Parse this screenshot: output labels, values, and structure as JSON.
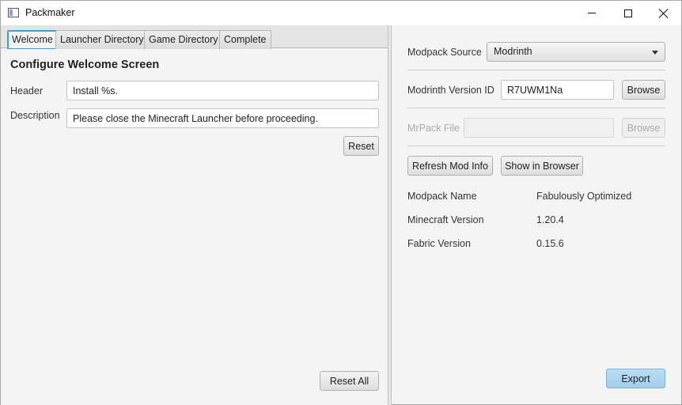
{
  "window": {
    "title": "Packmaker"
  },
  "tabs": [
    {
      "label": "Welcome",
      "active": true
    },
    {
      "label": "Launcher Directory",
      "active": false
    },
    {
      "label": "Game Directory",
      "active": false
    },
    {
      "label": "Complete",
      "active": false
    }
  ],
  "welcome": {
    "section_title": "Configure Welcome Screen",
    "header_label": "Header",
    "header_value": "Install %s.",
    "description_label": "Description",
    "description_value": "Please close the Minecraft Launcher before proceeding.",
    "reset_label": "Reset",
    "reset_all_label": "Reset All"
  },
  "source": {
    "label": "Modpack Source",
    "selected": "Modrinth"
  },
  "modrinth": {
    "label": "Modrinth Version ID",
    "value": "R7UWM1Na",
    "browse_label": "Browse"
  },
  "mrpack": {
    "label": "MrPack File",
    "value": "",
    "browse_label": "Browse"
  },
  "actions": {
    "refresh_label": "Refresh Mod Info",
    "show_browser_label": "Show in Browser"
  },
  "info": {
    "modpack_name_label": "Modpack Name",
    "modpack_name_value": "Fabulously Optimized",
    "minecraft_version_label": "Minecraft Version",
    "minecraft_version_value": "1.20.4",
    "fabric_version_label": "Fabric Version",
    "fabric_version_value": "0.15.6"
  },
  "export_label": "Export"
}
